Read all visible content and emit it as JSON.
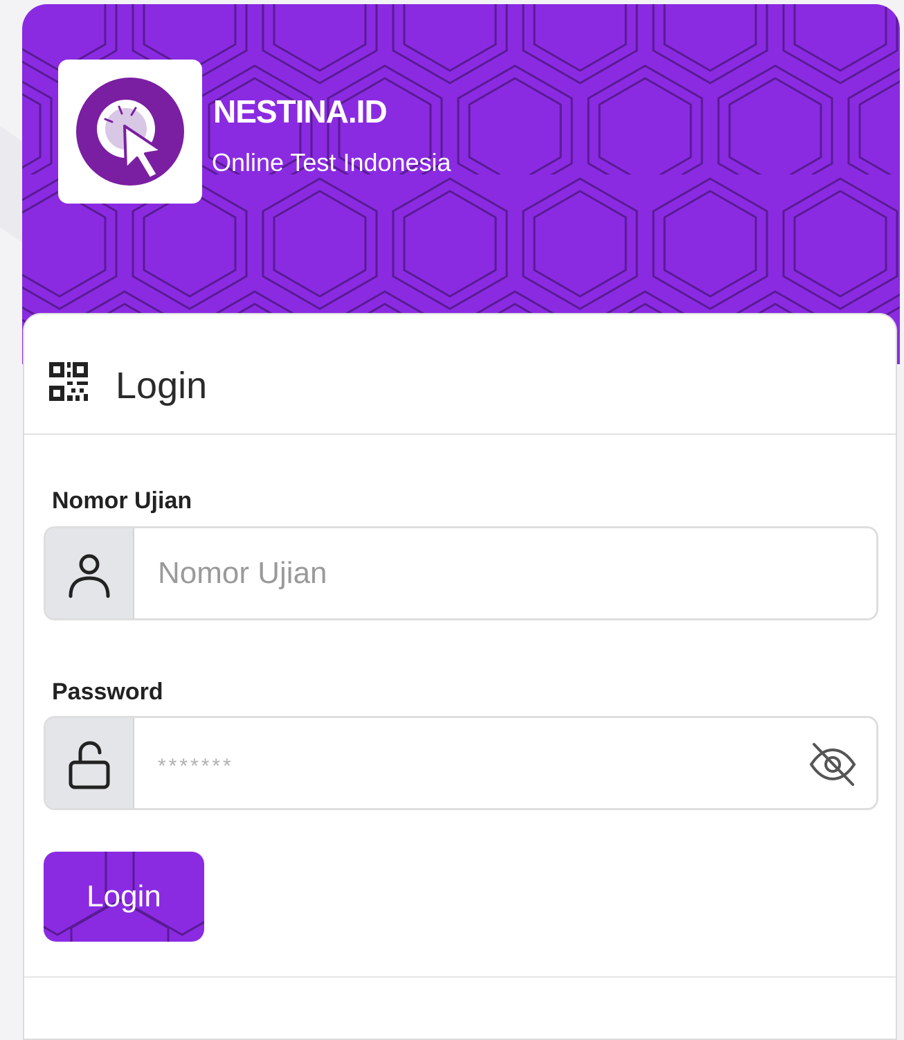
{
  "brand": {
    "name": "NESTINA.ID",
    "tagline": "Online Test Indonesia",
    "color": "#8a2be2",
    "logo_icon": "cursor-click-icon"
  },
  "card": {
    "title": "Login",
    "title_icon": "qr-code-icon"
  },
  "form": {
    "exam_number": {
      "label": "Nomor Ujian",
      "placeholder": "Nomor Ujian",
      "value": "",
      "icon": "user-icon"
    },
    "password": {
      "label": "Password",
      "placeholder": "*******",
      "value": "",
      "icon": "unlock-icon",
      "toggle_icon": "eye-slash-icon"
    },
    "submit_label": "Login"
  }
}
